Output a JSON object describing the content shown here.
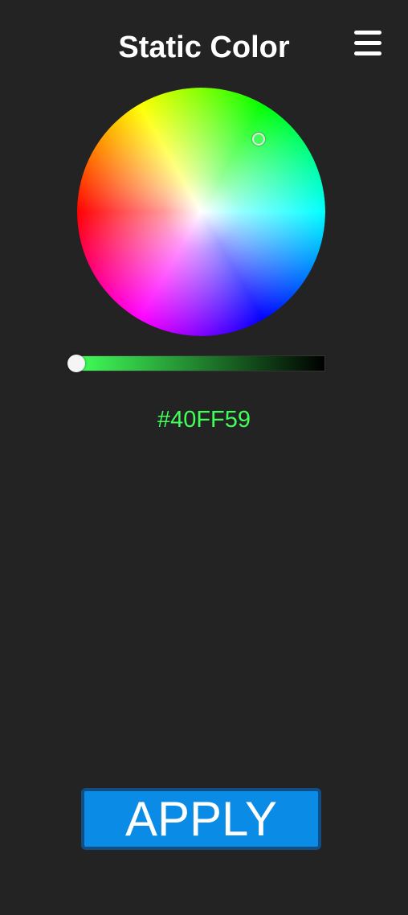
{
  "header": {
    "title": "Static Color",
    "menu_icon": "hamburger-menu-icon"
  },
  "color_picker": {
    "selected_hex": "#40FF59",
    "selected_color": "#40ff59",
    "brightness": 1.0
  },
  "actions": {
    "apply_label": "APPLY",
    "apply_color": "#0a8ce6"
  },
  "theme": {
    "background": "#232323",
    "text": "#ffffff"
  }
}
